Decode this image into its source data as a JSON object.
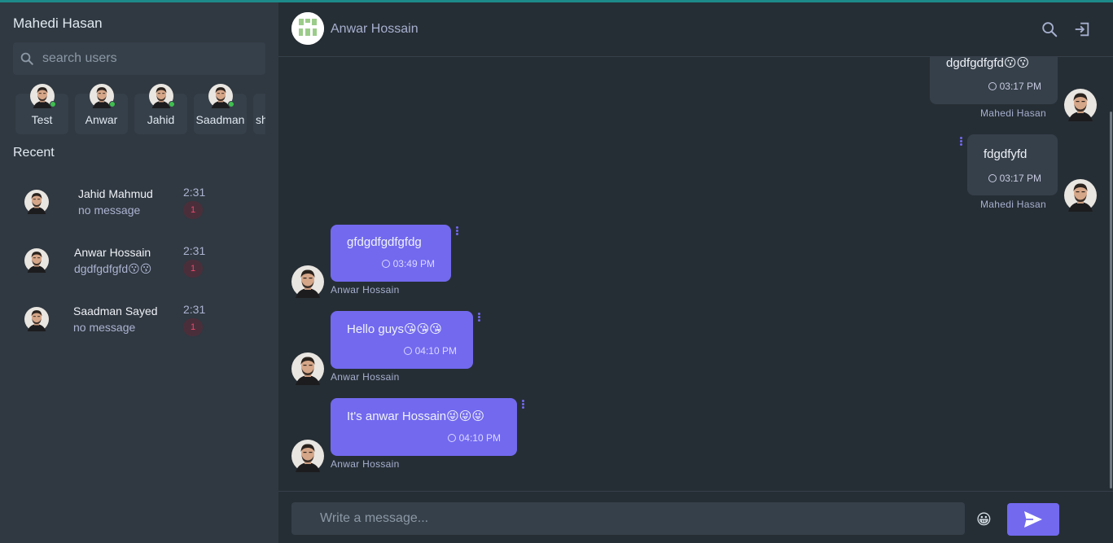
{
  "sidebar": {
    "user_name": "Mahedi Hasan",
    "search": {
      "placeholder": "search users"
    },
    "online_users": [
      {
        "name": "Test"
      },
      {
        "name": "Anwar"
      },
      {
        "name": "Jahid"
      },
      {
        "name": "Saadman"
      },
      {
        "name": "sh"
      }
    ],
    "recent_title": "Recent",
    "conversations": [
      {
        "name": "Jahid Mahmud",
        "last_message": "no message",
        "time": "2:31",
        "unread": "1"
      },
      {
        "name": "Anwar Hossain",
        "last_message": "dgdfgdfgfd😗😗",
        "time": "2:31",
        "unread": "1"
      },
      {
        "name": "Saadman Sayed",
        "last_message": "no message",
        "time": "2:31",
        "unread": "1"
      }
    ]
  },
  "chat": {
    "contact_name": "Anwar Hossain",
    "messages": [
      {
        "text": "dgdfgdfgfd😗😗",
        "time": "03:17 PM",
        "sender": "Mahedi Hasan",
        "direction": "outgoing"
      },
      {
        "text": "fdgdfyfd",
        "time": "03:17 PM",
        "sender": "Mahedi Hasan",
        "direction": "outgoing"
      },
      {
        "text": "gfdgdfgdfgfdg",
        "time": "03:49 PM",
        "sender": "Anwar Hossain",
        "direction": "incoming"
      },
      {
        "text": "Hello guys😘😘😘",
        "time": "04:10 PM",
        "sender": "Anwar Hossain",
        "direction": "incoming"
      },
      {
        "text": "It's anwar Hossain😜😜😜",
        "time": "04:10 PM",
        "sender": "Anwar Hossain",
        "direction": "incoming"
      }
    ],
    "composer": {
      "placeholder": "Write a message...",
      "emoji": "😀"
    }
  },
  "colors": {
    "accent": "#7269ef",
    "online_dot": "#3fbf4f",
    "unread_badge": "#ef476f",
    "sidebar_bg": "#303841",
    "main_bg": "#262e35"
  },
  "icons": [
    "search-icon",
    "logout-icon",
    "send-icon",
    "clock-icon",
    "more-vertical-icon"
  ]
}
